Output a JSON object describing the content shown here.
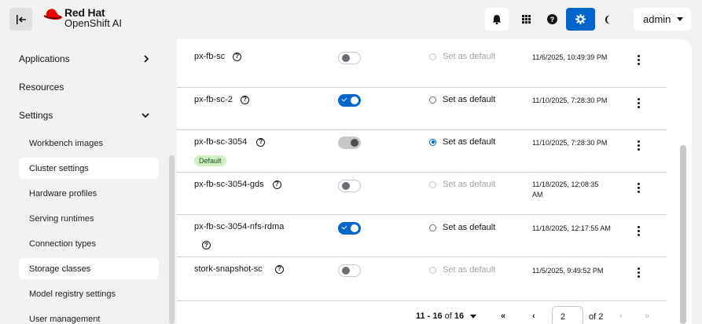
{
  "header": {
    "brand": "Red Hat",
    "product": "OpenShift AI",
    "user": "admin",
    "icons": [
      "bell-icon",
      "grid-icon",
      "help-icon",
      "gear-icon",
      "moon-icon"
    ]
  },
  "sidebar": {
    "groups": [
      {
        "label": "Applications"
      },
      {
        "label": "Resources"
      },
      {
        "label": "Settings"
      }
    ],
    "settings_items": [
      {
        "label": "Workbench images"
      },
      {
        "label": "Cluster settings"
      },
      {
        "label": "Hardware profiles"
      },
      {
        "label": "Serving runtimes"
      },
      {
        "label": "Connection types"
      },
      {
        "label": "Storage classes"
      },
      {
        "label": "Model registry settings"
      },
      {
        "label": "User management"
      }
    ]
  },
  "table": {
    "rows": [
      {
        "name": "px-fb-sc",
        "enabled": false,
        "default_label": "Set as default",
        "default_state": "disabled",
        "timestamp": "11/6/2025, 10:49:39 PM"
      },
      {
        "name": "px-fb-sc-2",
        "enabled": true,
        "default_label": "Set as default",
        "default_state": "unchecked",
        "timestamp": "11/10/2025, 7:28:30 PM"
      },
      {
        "name": "px-fb-sc-3054",
        "badge": "Default",
        "enabled": true,
        "toggle_disabled": true,
        "default_label": "Set as default",
        "default_state": "checked",
        "timestamp": "11/10/2025, 7:28:30 PM"
      },
      {
        "name": "px-fb-sc-3054-gds",
        "enabled": false,
        "default_label": "Set as default",
        "default_state": "disabled",
        "timestamp_line1": "11/18/2025, 12:08:35",
        "timestamp_line2": "AM"
      },
      {
        "name": "px-fb-sc-3054-nfs-rdma",
        "enabled": true,
        "default_label": "Set as default",
        "default_state": "unchecked",
        "timestamp": "11/18/2025, 12:17:55 AM"
      },
      {
        "name": "stork-snapshot-sc",
        "enabled": false,
        "default_label": "Set as default",
        "default_state": "disabled",
        "timestamp": "11/5/2025, 9:49:52 PM"
      }
    ]
  },
  "pagination": {
    "range": "11 - 16",
    "of_label": "of",
    "total": "16",
    "page": "2",
    "of_pages": "of 2",
    "first_icon": "«",
    "prev_icon": "‹",
    "next_icon": "›",
    "last_icon": "»"
  },
  "colors": {
    "accent": "#0066cc",
    "badge_bg": "#d1f0c2"
  }
}
